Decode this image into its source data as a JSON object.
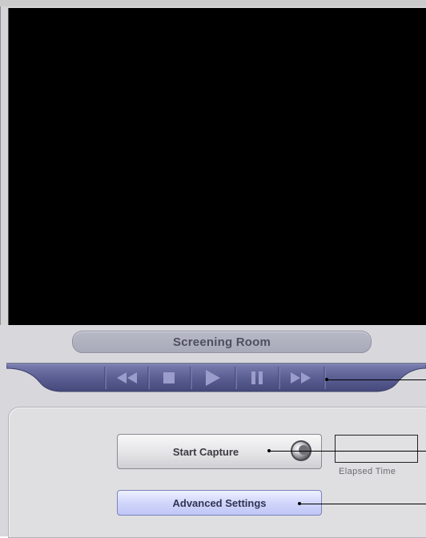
{
  "player": {
    "title": "Screening Room"
  },
  "transport": {
    "buttons": [
      {
        "name": "rewind",
        "icon": "rewind-icon"
      },
      {
        "name": "stop",
        "icon": "stop-icon"
      },
      {
        "name": "play",
        "icon": "play-icon"
      },
      {
        "name": "pause",
        "icon": "pause-icon"
      },
      {
        "name": "fast-forward",
        "icon": "fast-forward-icon"
      }
    ]
  },
  "capture": {
    "start_label": "Start Capture",
    "advanced_label": "Advanced Settings",
    "elapsed_value": "",
    "elapsed_label": "Elapsed Time"
  },
  "colors": {
    "video_background": "#000000",
    "panel": "#dfdfe2",
    "transport_bar": "#5b5f93",
    "advanced_button": "#c7cdf8"
  }
}
